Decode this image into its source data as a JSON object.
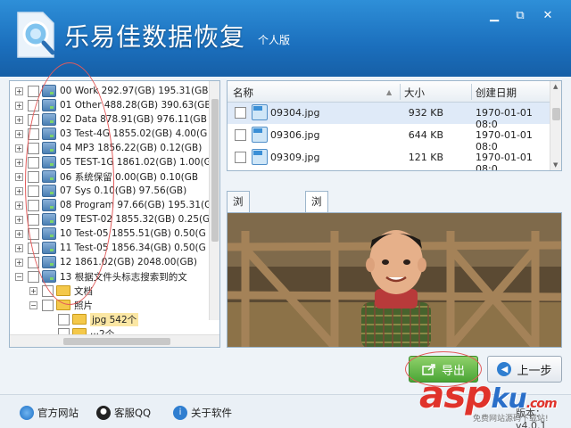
{
  "header": {
    "title": "乐易佳数据恢复",
    "edition": "个人版"
  },
  "tree": {
    "rows": [
      {
        "label": "00 Work 292.97(GB) 195.31(GB",
        "type": "drive"
      },
      {
        "label": "01 Other 488.28(GB) 390.63(GB",
        "type": "drive"
      },
      {
        "label": "02 Data 878.91(GB) 976.11(GB",
        "type": "drive"
      },
      {
        "label": "03 Test-4G 1855.02(GB) 4.00(G",
        "type": "drive"
      },
      {
        "label": "04 MP3 1856.22(GB) 0.12(GB)",
        "type": "drive"
      },
      {
        "label": "05 TEST-1G 1861.02(GB) 1.00(G",
        "type": "drive"
      },
      {
        "label": "06 系统保留 0.00(GB) 0.10(GB",
        "type": "drive"
      },
      {
        "label": "07 Sys 0.10(GB) 97.56(GB)",
        "type": "drive"
      },
      {
        "label": "08 Program 97.66(GB) 195.31(G",
        "type": "drive"
      },
      {
        "label": "09 TEST-02 1855.32(GB) 0.25(G",
        "type": "drive"
      },
      {
        "label": "10 Test-05 1855.51(GB) 0.50(G",
        "type": "drive"
      },
      {
        "label": "11 Test-05 1856.34(GB) 0.50(G",
        "type": "drive"
      },
      {
        "label": "12   1861.02(GB) 2048.00(GB)",
        "type": "drive"
      },
      {
        "label": "13 根据文件头标志搜索到的文",
        "type": "drive"
      },
      {
        "label": "文档",
        "type": "folder"
      },
      {
        "label": "照片",
        "type": "folder"
      },
      {
        "label": "jpg 542个",
        "type": "folder"
      },
      {
        "label": "···2个",
        "type": "folder"
      }
    ]
  },
  "file_list": {
    "columns": [
      "名称",
      "大小",
      "创建日期"
    ],
    "rows": [
      {
        "name": "09304.jpg",
        "size": "932 KB",
        "date": "1970-01-01 08:0",
        "selected": true
      },
      {
        "name": "09306.jpg",
        "size": "644 KB",
        "date": "1970-01-01 08:0",
        "selected": false
      },
      {
        "name": "09309.jpg",
        "size": "121 KB",
        "date": "1970-01-01 08:0",
        "selected": false
      }
    ]
  },
  "tabs": [
    "浏览十六进制",
    "浏览图像"
  ],
  "buttons": {
    "export": "导出",
    "prev": "上一步"
  },
  "footer": {
    "website": "官方网站",
    "support": "客服QQ",
    "about": "关于软件",
    "version": "版本：v4.0.1"
  },
  "watermark": {
    "main": "asp",
    "sub": "ku",
    "tag": ".com",
    "caption": "免费网站源码下载站!"
  },
  "colors": {
    "header": "#1b6fbd",
    "export_btn": "#4aa536",
    "annotation": "#e35a5a"
  }
}
